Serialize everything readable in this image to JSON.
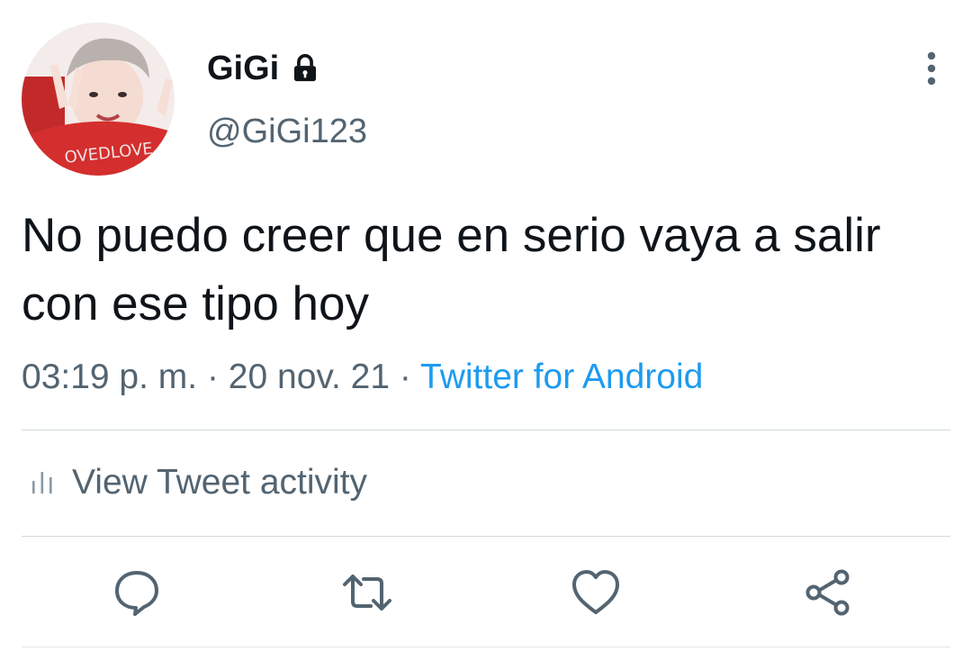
{
  "tweet": {
    "display_name": "GiGi",
    "handle": "@GiGi123",
    "text": "No puedo creer que en serio vaya a salir con ese tipo hoy",
    "time": "03:19 p. m.",
    "separator": " · ",
    "date": "20 nov. 21",
    "source": "Twitter for Android",
    "protected_icon": "lock-icon",
    "avatar_shirt_text": "OVEDLOVE"
  },
  "activity": {
    "label": "View Tweet activity",
    "icon": "bar-chart-icon"
  },
  "actions": [
    "reply-icon",
    "retweet-icon",
    "like-icon",
    "share-icon"
  ],
  "colors": {
    "primary_text": "#0f1419",
    "secondary_text": "#536471",
    "link": "#1d9bf0",
    "divider": "#cfd9de"
  }
}
